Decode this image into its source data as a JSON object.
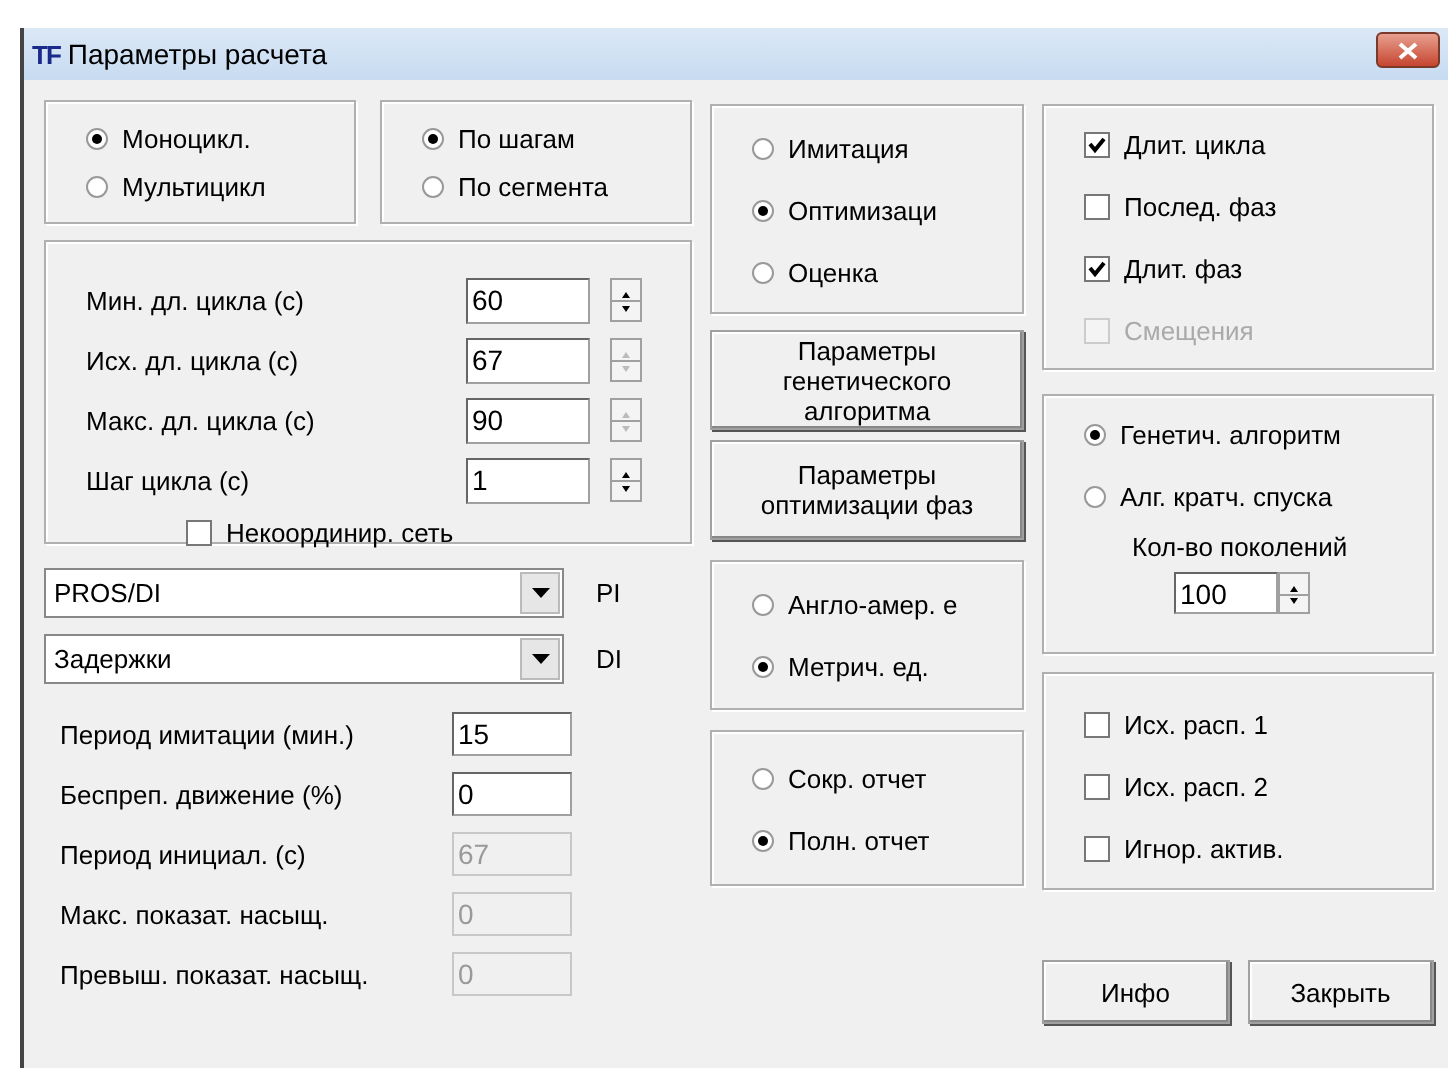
{
  "window": {
    "logo": "TF",
    "title": "Параметры расчета"
  },
  "cycle_mode": [
    {
      "label": "Моноцикл.",
      "selected": true
    },
    {
      "label": "Мультицикл",
      "selected": false
    }
  ],
  "step_mode": [
    {
      "label": "По шагам",
      "selected": true
    },
    {
      "label": "По сегмента",
      "selected": false
    }
  ],
  "cycle_fields": [
    {
      "label": "Мин. дл. цикла (с)",
      "value": "60",
      "spin_disabled": false
    },
    {
      "label": "Исх. дл. цикла (с)",
      "value": "67",
      "spin_disabled": true
    },
    {
      "label": "Макс. дл. цикла (с)",
      "value": "90",
      "spin_disabled": true
    },
    {
      "label": "Шаг цикла (с)",
      "value": "1",
      "spin_disabled": false
    }
  ],
  "uncoordinated": {
    "label": "Некоординир. сеть",
    "checked": false
  },
  "combos": [
    {
      "value": "PROS/DI",
      "suffix": "PI"
    },
    {
      "value": "Задержки",
      "suffix": "DI"
    }
  ],
  "fields": [
    {
      "label": "Период имитации (мин.)",
      "value": "15",
      "disabled": false
    },
    {
      "label": "Беспреп. движение (%)",
      "value": "0",
      "disabled": false
    },
    {
      "label": "Период инициал. (с)",
      "value": "67",
      "disabled": true
    },
    {
      "label": "Макс. показат. насыщ.",
      "value": "0",
      "disabled": true
    },
    {
      "label": "Превыш. показат. насыщ.",
      "value": "0",
      "disabled": true
    }
  ],
  "mode": [
    {
      "label": "Имитация",
      "selected": false
    },
    {
      "label": "Оптимизаци",
      "selected": true
    },
    {
      "label": "Оценка",
      "selected": false
    }
  ],
  "param_buttons": [
    "Параметры генетического алгоритма",
    "Параметры оптимизации фаз"
  ],
  "units": [
    {
      "label": "Англо-амер. е",
      "selected": false
    },
    {
      "label": "Метрич. ед.",
      "selected": true
    }
  ],
  "report": [
    {
      "label": "Сокр. отчет",
      "selected": false
    },
    {
      "label": "Полн. отчет",
      "selected": true
    }
  ],
  "opt_targets": [
    {
      "label": "Длит. цикла",
      "checked": true,
      "disabled": false
    },
    {
      "label": "Послед. фаз",
      "checked": false,
      "disabled": false
    },
    {
      "label": "Длит. фаз",
      "checked": true,
      "disabled": false
    },
    {
      "label": "Смещения",
      "checked": false,
      "disabled": true
    }
  ],
  "algorithm": [
    {
      "label": "Генетич. алгоритм",
      "selected": true
    },
    {
      "label": "Алг. кратч. спуска",
      "selected": false
    }
  ],
  "generations": {
    "label": "Кол-во поколений",
    "value": "100"
  },
  "options": [
    {
      "label": "Исх. расп. 1",
      "checked": false,
      "disabled": false
    },
    {
      "label": "Исх. расп. 2",
      "checked": false,
      "disabled": false
    },
    {
      "label": "Игнор. актив.",
      "checked": false,
      "disabled": false
    }
  ],
  "buttons": [
    "Инфо",
    "Закрыть"
  ]
}
